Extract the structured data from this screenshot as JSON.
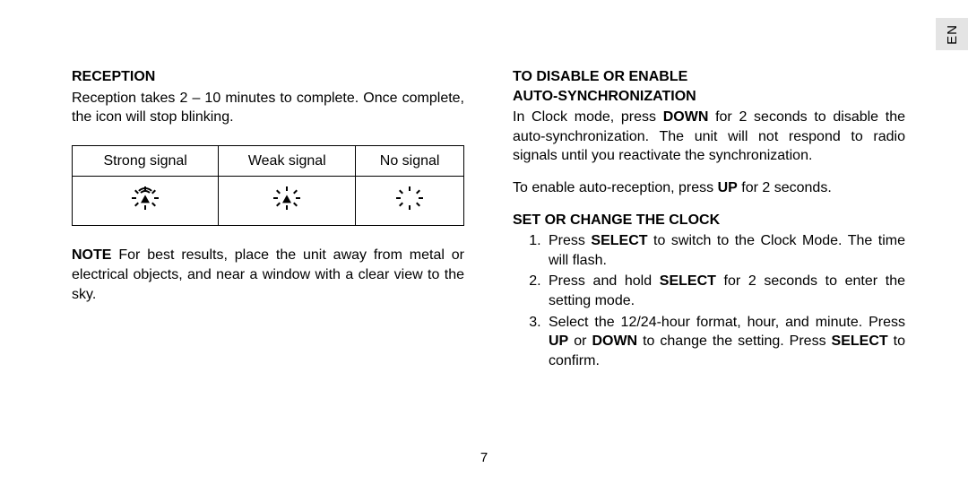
{
  "lang_tab": "EN",
  "page_number": "7",
  "left": {
    "heading": "RECEPTION",
    "intro": "Reception takes 2 – 10 minutes to complete.  Once complete, the icon will stop blinking.",
    "table": {
      "h1": "Strong signal",
      "h2": "Weak signal",
      "h3": "No signal"
    },
    "note_label": "NOTE",
    "note_text": "  For best results, place the unit away from metal or electrical objects, and near a window with a clear view to the sky."
  },
  "right": {
    "heading1_line1": "TO DISABLE OR ENABLE",
    "heading1_line2": "AUTO-SYNCHRONIZATION",
    "para1_pre": "In Clock mode, press ",
    "para1_b1": "DOWN",
    "para1_post": " for 2 seconds to disable the auto-synchronization. The unit will not respond to radio signals until you reactivate the synchronization.",
    "para2_pre": "To enable auto-reception, press ",
    "para2_b": "UP",
    "para2_post": " for 2 seconds.",
    "heading2": "SET OR CHANGE THE CLOCK",
    "steps": {
      "s1_pre": "Press ",
      "s1_b": "SELECT",
      "s1_post": " to switch to the Clock Mode.  The time will flash.",
      "s2_pre": "Press and hold ",
      "s2_b": "SELECT",
      "s2_post": " for 2 seconds to enter the setting mode.",
      "s3_pre": "Select the 12/24-hour format, hour, and minute.  Press ",
      "s3_b1": "UP",
      "s3_mid1": " or ",
      "s3_b2": "DOWN",
      "s3_mid2": " to change the setting.   Press ",
      "s3_b3": "SELECT",
      "s3_post": " to confirm."
    }
  }
}
